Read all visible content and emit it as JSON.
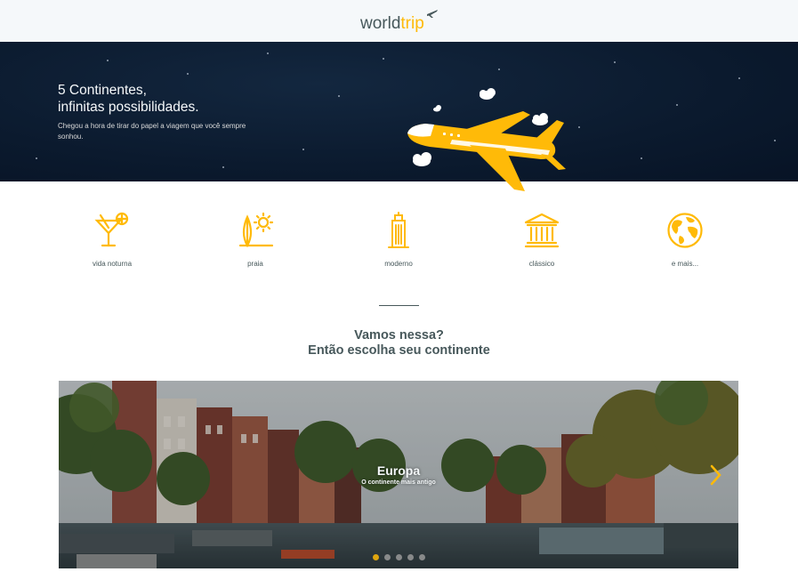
{
  "header": {
    "logo_world": "world",
    "logo_trip": "trip",
    "logo_icon": "airplane-icon"
  },
  "hero": {
    "title_line1": "5 Continentes,",
    "title_line2": "infinitas possibilidades.",
    "subtitle": "Chegou a hora de tirar do papel a viagem que você sempre sonhou.",
    "illustration": "airplane-with-clouds"
  },
  "travel_types": [
    {
      "label": "vida noturna",
      "icon": "cocktail-icon"
    },
    {
      "label": "praia",
      "icon": "surf-sun-icon"
    },
    {
      "label": "moderno",
      "icon": "building-icon"
    },
    {
      "label": "clássico",
      "icon": "museum-icon"
    },
    {
      "label": "e mais...",
      "icon": "earth-icon"
    }
  ],
  "cta": {
    "line1": "Vamos nessa?",
    "line2": "Então escolha seu continente"
  },
  "slider": {
    "title": "Europa",
    "subtitle": "O continente mais antigo",
    "slide_count": 5,
    "active_index": 0,
    "next_icon": "chevron-right-icon"
  },
  "colors": {
    "accent": "#FFBA08",
    "dark_text": "#47585B",
    "light": "#F5F8FA",
    "hero_bg": "#0b1a2e"
  }
}
